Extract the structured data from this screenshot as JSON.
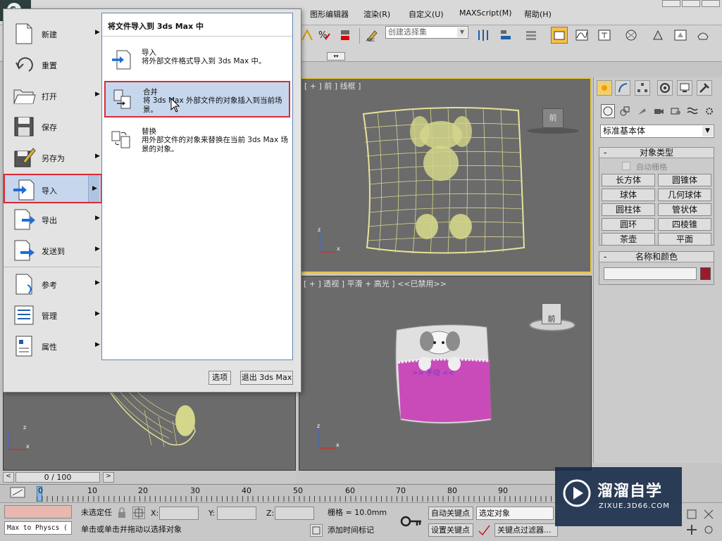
{
  "menubar": {
    "items": [
      "图形编辑器",
      "渲染(R)",
      "自定义(U)",
      "MAXScript(M)",
      "帮助(H)"
    ]
  },
  "toolbar": {
    "selection_set_placeholder": "创建选择集"
  },
  "viewports": {
    "front_label": "[ + ] 前 ] 线框 ]",
    "perspective_label": "[ + ] 透视 ] 平滑 + 高光 ] <<已禁用>>",
    "front_cube_label": "前",
    "perspective_cube_label": "前",
    "overlay_text": ">> 手动 <<"
  },
  "command_panel": {
    "category": "标准基本体",
    "object_type_title": "对象类型",
    "autogrid_label": "自动栅格",
    "buttons": [
      "长方体",
      "圆锥体",
      "球体",
      "几何球体",
      "圆柱体",
      "管状体",
      "圆环",
      "四棱锥",
      "茶壶",
      "平面"
    ],
    "name_color_title": "名称和颜色",
    "color_swatch": "#9c1a2e"
  },
  "app_menu": {
    "items": [
      {
        "label": "新建",
        "icon": "new-file-icon"
      },
      {
        "label": "重置",
        "icon": "reset-icon"
      },
      {
        "label": "打开",
        "icon": "open-folder-icon"
      },
      {
        "label": "保存",
        "icon": "save-disk-icon"
      },
      {
        "label": "另存为",
        "icon": "save-as-icon"
      },
      {
        "label": "导入",
        "icon": "import-icon"
      },
      {
        "label": "导出",
        "icon": "export-icon"
      },
      {
        "label": "发送到",
        "icon": "send-to-icon"
      },
      {
        "label": "参考",
        "icon": "reference-icon"
      },
      {
        "label": "管理",
        "icon": "manage-icon"
      },
      {
        "label": "属性",
        "icon": "properties-icon"
      }
    ],
    "submenu_title": "将文件导入到 3ds Max 中",
    "submenu": [
      {
        "title": "导入",
        "desc": "将外部文件格式导入到 3ds Max 中。"
      },
      {
        "title": "合并",
        "desc": "将 3ds Max 外部文件的对象插入到当前场景。"
      },
      {
        "title": "替换",
        "desc": "用外部文件的对象来替换在当前 3ds Max 场景的对象。"
      }
    ],
    "options_button": "选项",
    "exit_button": "退出 3ds Max"
  },
  "timeline": {
    "frame_counter": "0 / 100",
    "ticks": [
      "0",
      "10",
      "20",
      "30",
      "40",
      "50",
      "60",
      "70",
      "80",
      "90"
    ]
  },
  "status": {
    "script_listener": "Max to Physcs (",
    "selection": "未选定任",
    "x_label": "X:",
    "y_label": "Y:",
    "z_label": "Z:",
    "grid": "栅格 = 10.0mm",
    "auto_key": "自动关键点",
    "set_key": "设置关键点",
    "key_filter_select": "选定对象",
    "key_filters": "关键点过滤器...",
    "prompt": "单击或单击并拖动以选择对象",
    "add_time_tag": "添加时间标记"
  },
  "watermark": {
    "brand": "溜溜自学",
    "url": "ZIXUE.3D66.COM"
  }
}
